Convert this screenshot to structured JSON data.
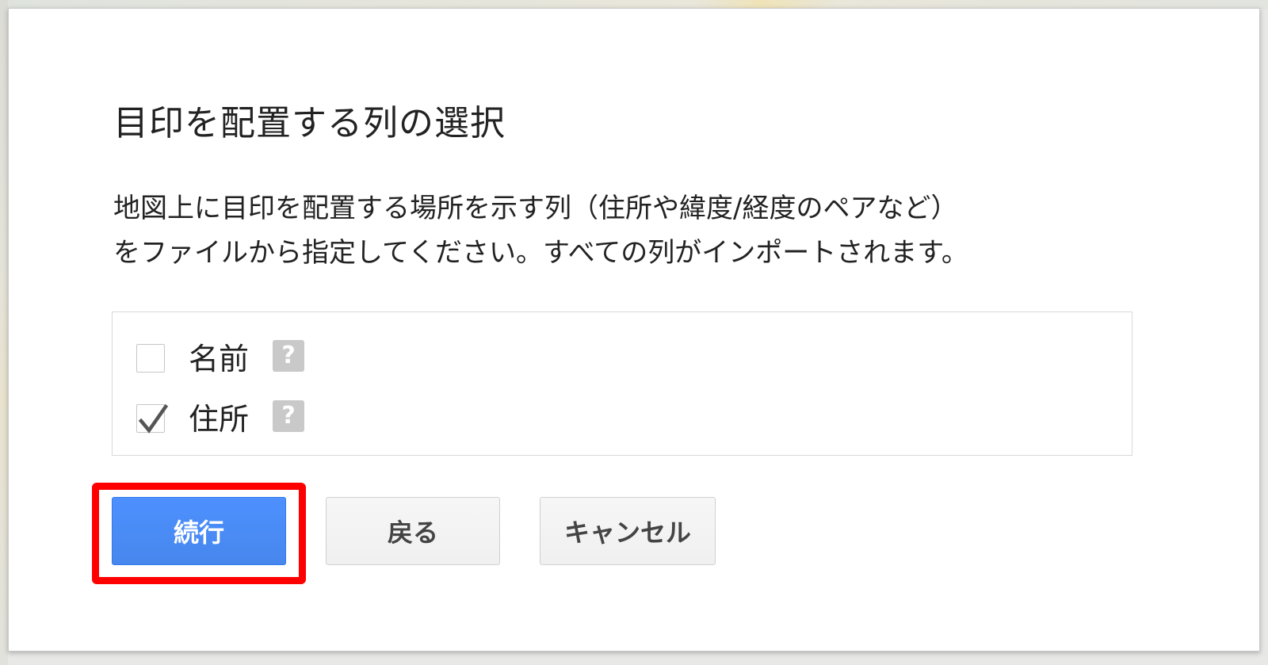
{
  "dialog": {
    "title": "目印を配置する列の選択",
    "description": [
      "地図上に目印を配置する場所を示す列（住所や緯度/経度のペアなど）",
      "をファイルから指定してください。すべての列がインポートされます。"
    ]
  },
  "columns": [
    {
      "label": "名前",
      "checked": false,
      "help": "?"
    },
    {
      "label": "住所",
      "checked": true,
      "help": "?"
    }
  ],
  "buttons": {
    "continue": "続行",
    "back": "戻る",
    "cancel": "キャンセル"
  },
  "colors": {
    "primary": "#4d90fe",
    "highlight": "#ff0000",
    "help_icon": "#c9c9c9"
  }
}
